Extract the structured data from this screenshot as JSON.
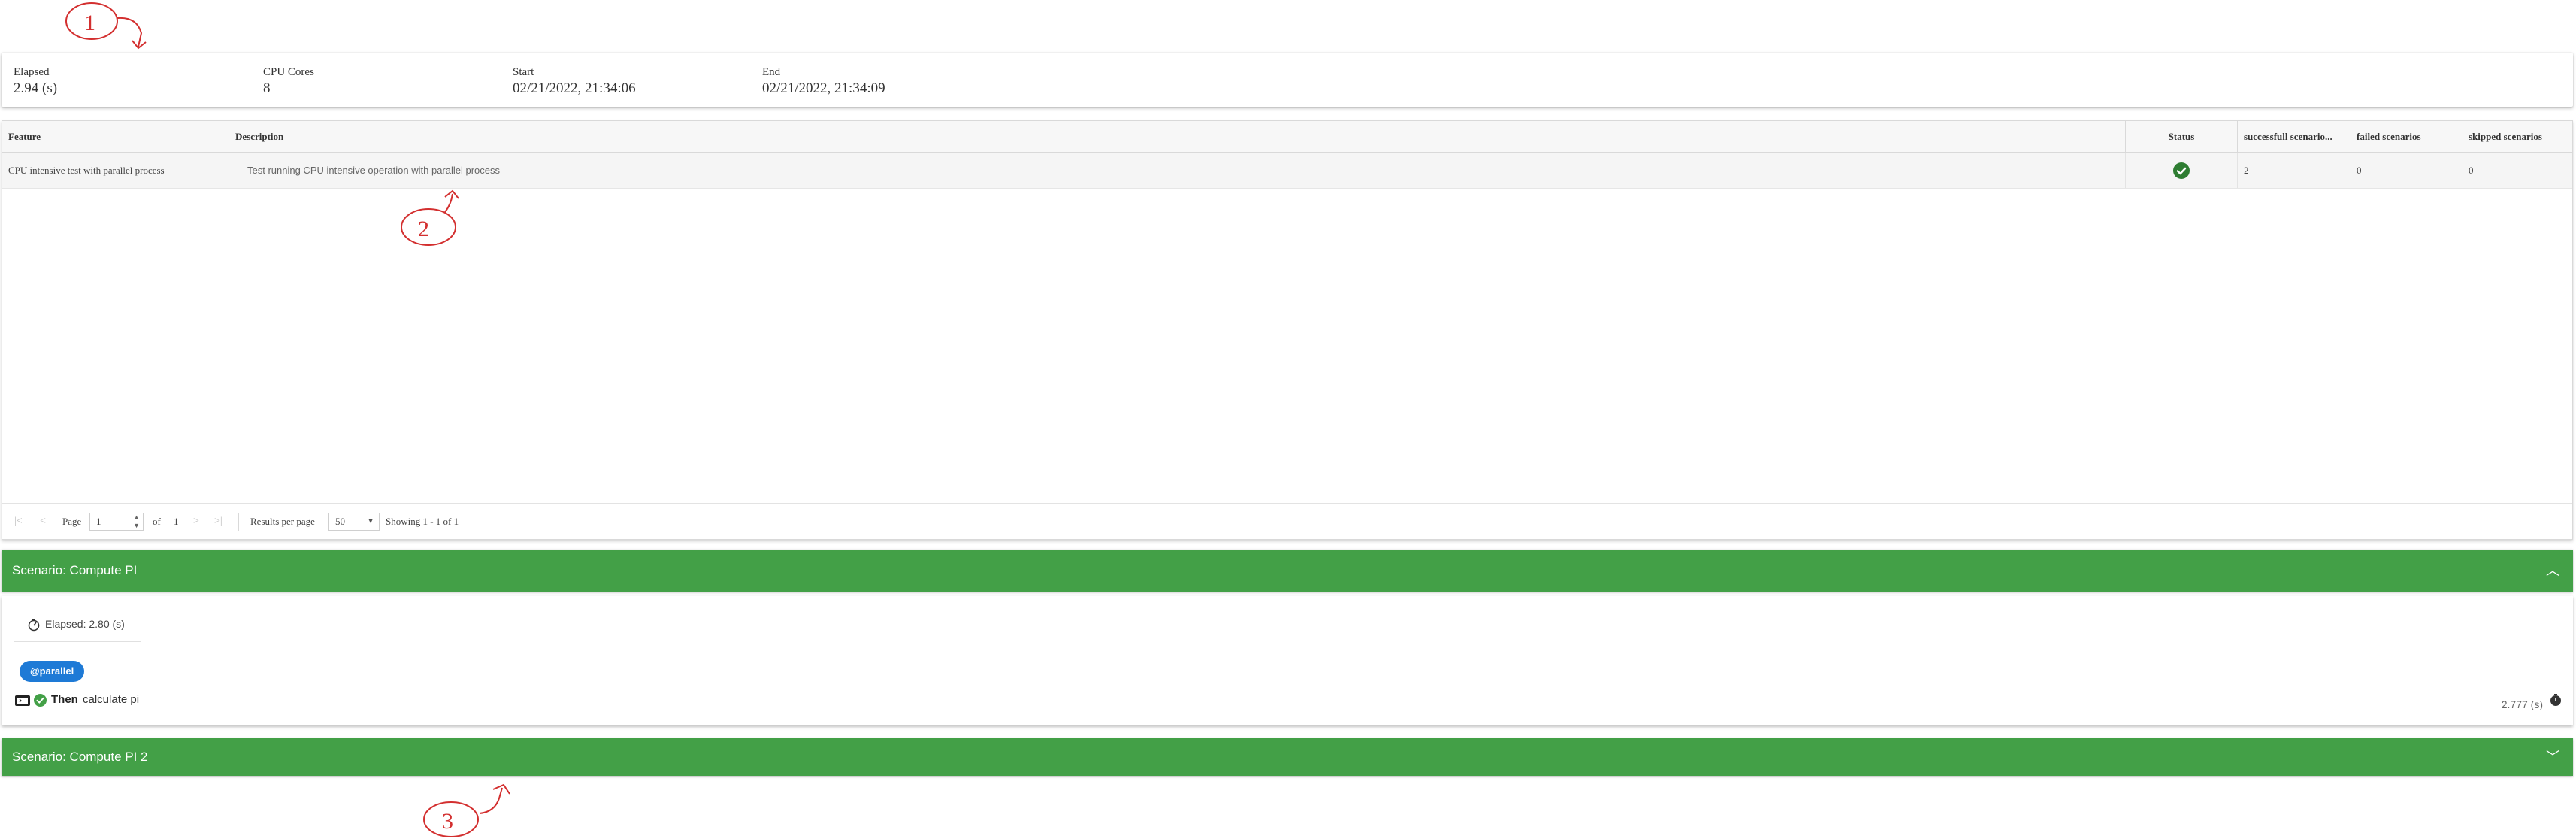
{
  "summary": {
    "elapsed": {
      "label": "Elapsed",
      "value": "2.94 (s)"
    },
    "cpu": {
      "label": "CPU Cores",
      "value": "8"
    },
    "start": {
      "label": "Start",
      "value": "02/21/2022, 21:34:06"
    },
    "end": {
      "label": "End",
      "value": "02/21/2022, 21:34:09"
    }
  },
  "grid": {
    "columns": [
      "Feature",
      "Description",
      "Status",
      "successfull scenario...",
      "failed scenarios",
      "skipped scenarios"
    ],
    "rows": [
      {
        "feature": "CPU intensive test with parallel process",
        "description": "Test running CPU intensive operation with parallel process",
        "status": "passed",
        "successful": "2",
        "failed": "0",
        "skipped": "0"
      }
    ],
    "pager": {
      "page_label": "Page",
      "page_value": "1",
      "of_label": "of",
      "total_pages": "1",
      "results_label": "Results per page",
      "per_page": "50",
      "showing": "Showing 1 - 1 of 1"
    }
  },
  "scenarios": [
    {
      "title": "Scenario: Compute PI",
      "expanded": true,
      "elapsed": "Elapsed: 2.80 (s)",
      "tag": "@parallel",
      "step_keyword": "Then",
      "step_text": "calculate pi",
      "step_time": "2.777 (s)"
    },
    {
      "title": "Scenario: Compute PI 2",
      "expanded": false
    }
  ],
  "annotations": [
    "1",
    "2",
    "3"
  ],
  "colors": {
    "success_green": "#43a047",
    "status_check": "#2e7d32",
    "tag_blue": "#1e7ad6",
    "annotation_red": "#d32f2f"
  }
}
